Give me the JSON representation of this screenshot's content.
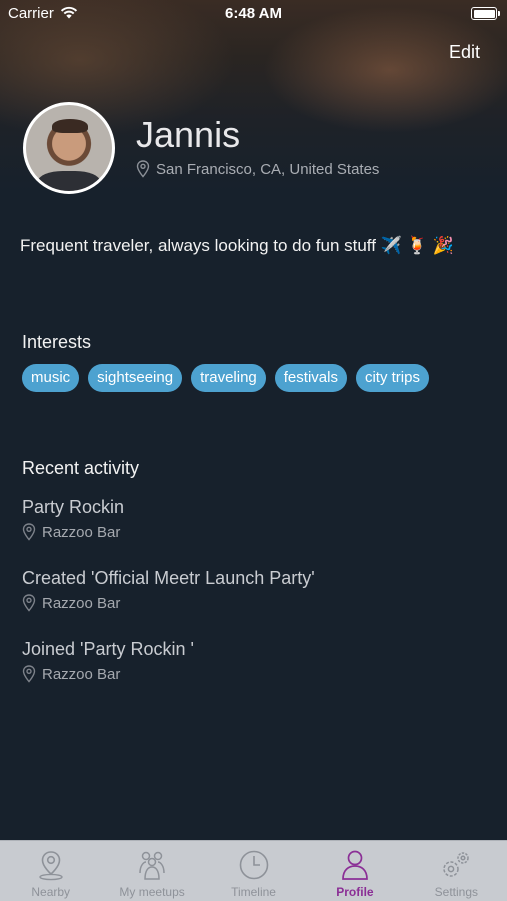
{
  "status_bar": {
    "carrier": "Carrier",
    "time": "6:48 AM"
  },
  "header": {
    "edit_label": "Edit"
  },
  "profile": {
    "name": "Jannis",
    "location": "San Francisco, CA, United States",
    "bio": "Frequent traveler, always looking to do fun stuff ✈️ 🍹 🎉"
  },
  "interests": {
    "title": "Interests",
    "tags": [
      "music",
      "sightseeing",
      "traveling",
      "festivals",
      "city trips"
    ]
  },
  "recent_activity": {
    "title": "Recent activity",
    "items": [
      {
        "title": "Party Rockin",
        "place": "Razzoo Bar"
      },
      {
        "title": "Created 'Official Meetr Launch Party'",
        "place": "Razzoo Bar"
      },
      {
        "title": "Joined 'Party Rockin '",
        "place": "Razzoo Bar"
      }
    ]
  },
  "tab_bar": {
    "tabs": [
      {
        "label": "Nearby",
        "icon": "location-pin-icon"
      },
      {
        "label": "My meetups",
        "icon": "group-icon"
      },
      {
        "label": "Timeline",
        "icon": "clock-icon"
      },
      {
        "label": "Profile",
        "icon": "person-icon"
      },
      {
        "label": "Settings",
        "icon": "gear-icon"
      }
    ],
    "active_index": 3,
    "active_color": "#8b2f96",
    "inactive_color": "#8e9299"
  },
  "colors": {
    "tag_background": "#4da2d0",
    "page_background": "#17212c"
  }
}
